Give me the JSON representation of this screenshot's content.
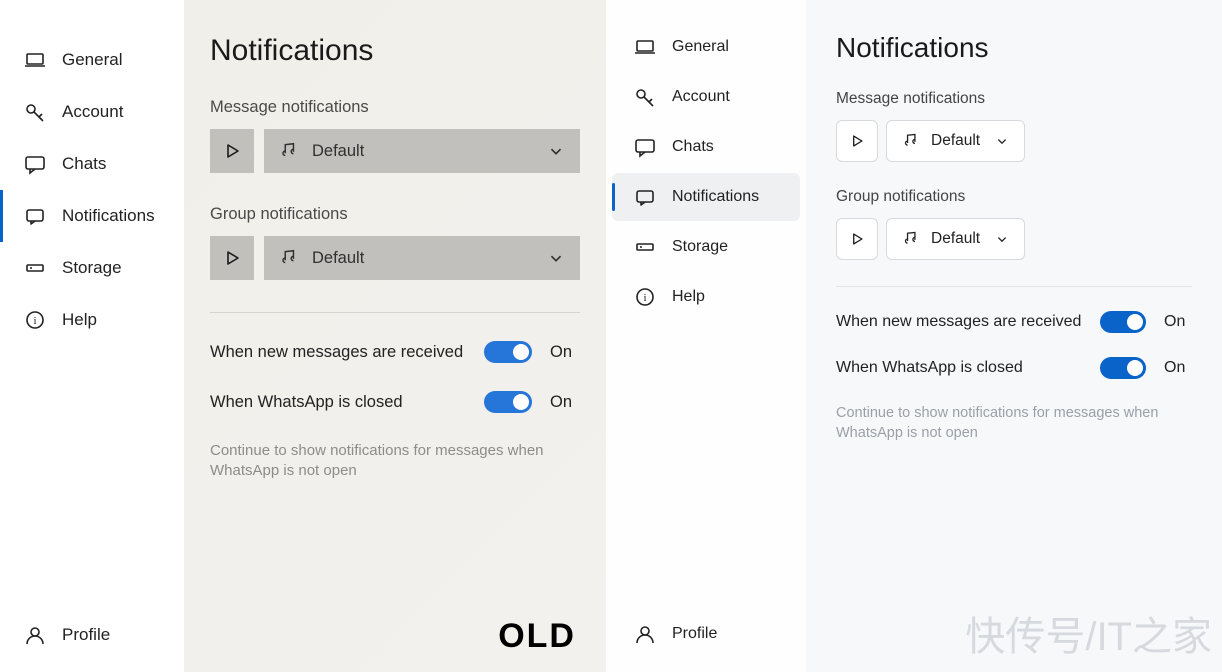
{
  "old": {
    "sidebar": {
      "items": [
        {
          "key": "general",
          "label": "General"
        },
        {
          "key": "account",
          "label": "Account"
        },
        {
          "key": "chats",
          "label": "Chats"
        },
        {
          "key": "notifications",
          "label": "Notifications",
          "active": true
        },
        {
          "key": "storage",
          "label": "Storage"
        },
        {
          "key": "help",
          "label": "Help"
        }
      ],
      "profile": "Profile"
    },
    "content": {
      "title": "Notifications",
      "message_section": "Message notifications",
      "message_tone": "Default",
      "group_section": "Group notifications",
      "group_tone": "Default",
      "toggle1_label": "When new messages are received",
      "toggle1_state": "On",
      "toggle2_label": "When WhatsApp is closed",
      "toggle2_state": "On",
      "help_text": "Continue to show notifications for messages when WhatsApp is not open",
      "badge": "OLD"
    }
  },
  "new": {
    "sidebar": {
      "items": [
        {
          "key": "general",
          "label": "General"
        },
        {
          "key": "account",
          "label": "Account"
        },
        {
          "key": "chats",
          "label": "Chats"
        },
        {
          "key": "notifications",
          "label": "Notifications",
          "active": true
        },
        {
          "key": "storage",
          "label": "Storage"
        },
        {
          "key": "help",
          "label": "Help"
        }
      ],
      "profile": "Profile"
    },
    "content": {
      "title": "Notifications",
      "message_section": "Message notifications",
      "message_tone": "Default",
      "group_section": "Group notifications",
      "group_tone": "Default",
      "toggle1_label": "When new messages are received",
      "toggle1_state": "On",
      "toggle2_label": "When WhatsApp is closed",
      "toggle2_state": "On",
      "help_text": "Continue to show notifications for messages when WhatsApp is not open"
    }
  },
  "watermark": "快传号/IT之家"
}
